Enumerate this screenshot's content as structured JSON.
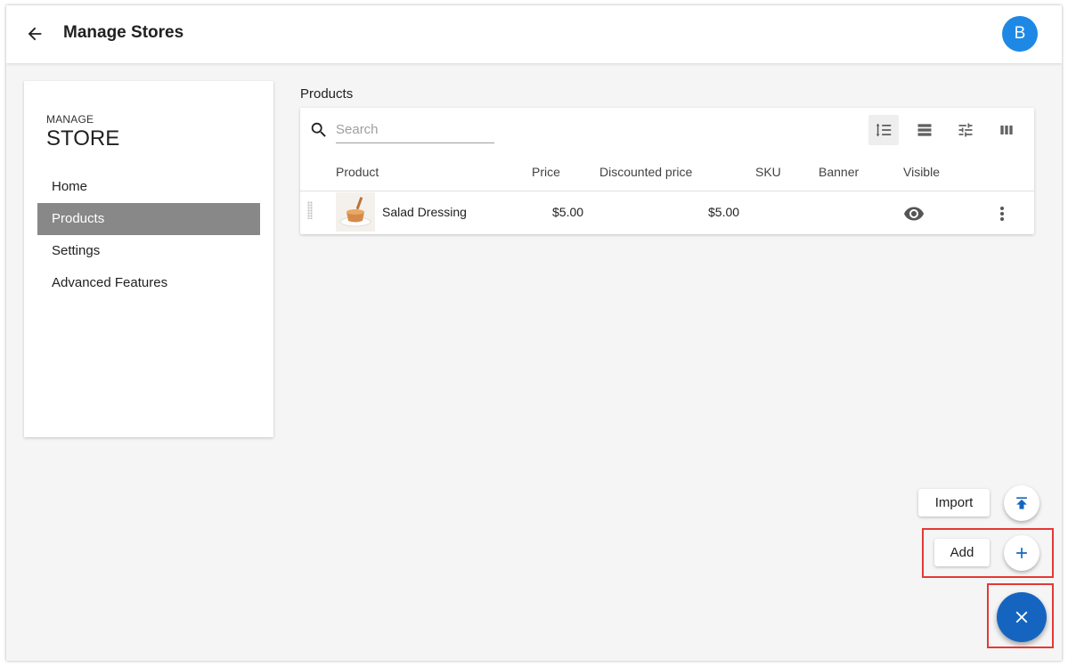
{
  "appbar": {
    "title": "Manage Stores",
    "avatar_letter": "B"
  },
  "sidebar": {
    "eyebrow": "MANAGE",
    "heading": "STORE",
    "items": [
      {
        "label": "Home",
        "active": false
      },
      {
        "label": "Products",
        "active": true
      },
      {
        "label": "Settings",
        "active": false
      },
      {
        "label": "Advanced Features",
        "active": false
      }
    ]
  },
  "main": {
    "section_title": "Products",
    "search": {
      "placeholder": "Search",
      "value": ""
    },
    "toolbar_icons": [
      "reorder-icon",
      "view-list-icon",
      "tune-icon",
      "view-column-icon"
    ],
    "columns": [
      "Product",
      "Price",
      "Discounted price",
      "SKU",
      "Banner",
      "Visible"
    ],
    "rows": [
      {
        "product": "Salad Dressing",
        "price": "$5.00",
        "discounted_price": "$5.00",
        "sku": "",
        "banner": "",
        "visible": true
      }
    ]
  },
  "speed_dial": {
    "import_label": "Import",
    "add_label": "Add",
    "fab_icon": "close-icon"
  },
  "colors": {
    "primary": "#1565c0",
    "avatar": "#1e88e5",
    "active_nav": "#888888",
    "highlight": "#e53935"
  }
}
